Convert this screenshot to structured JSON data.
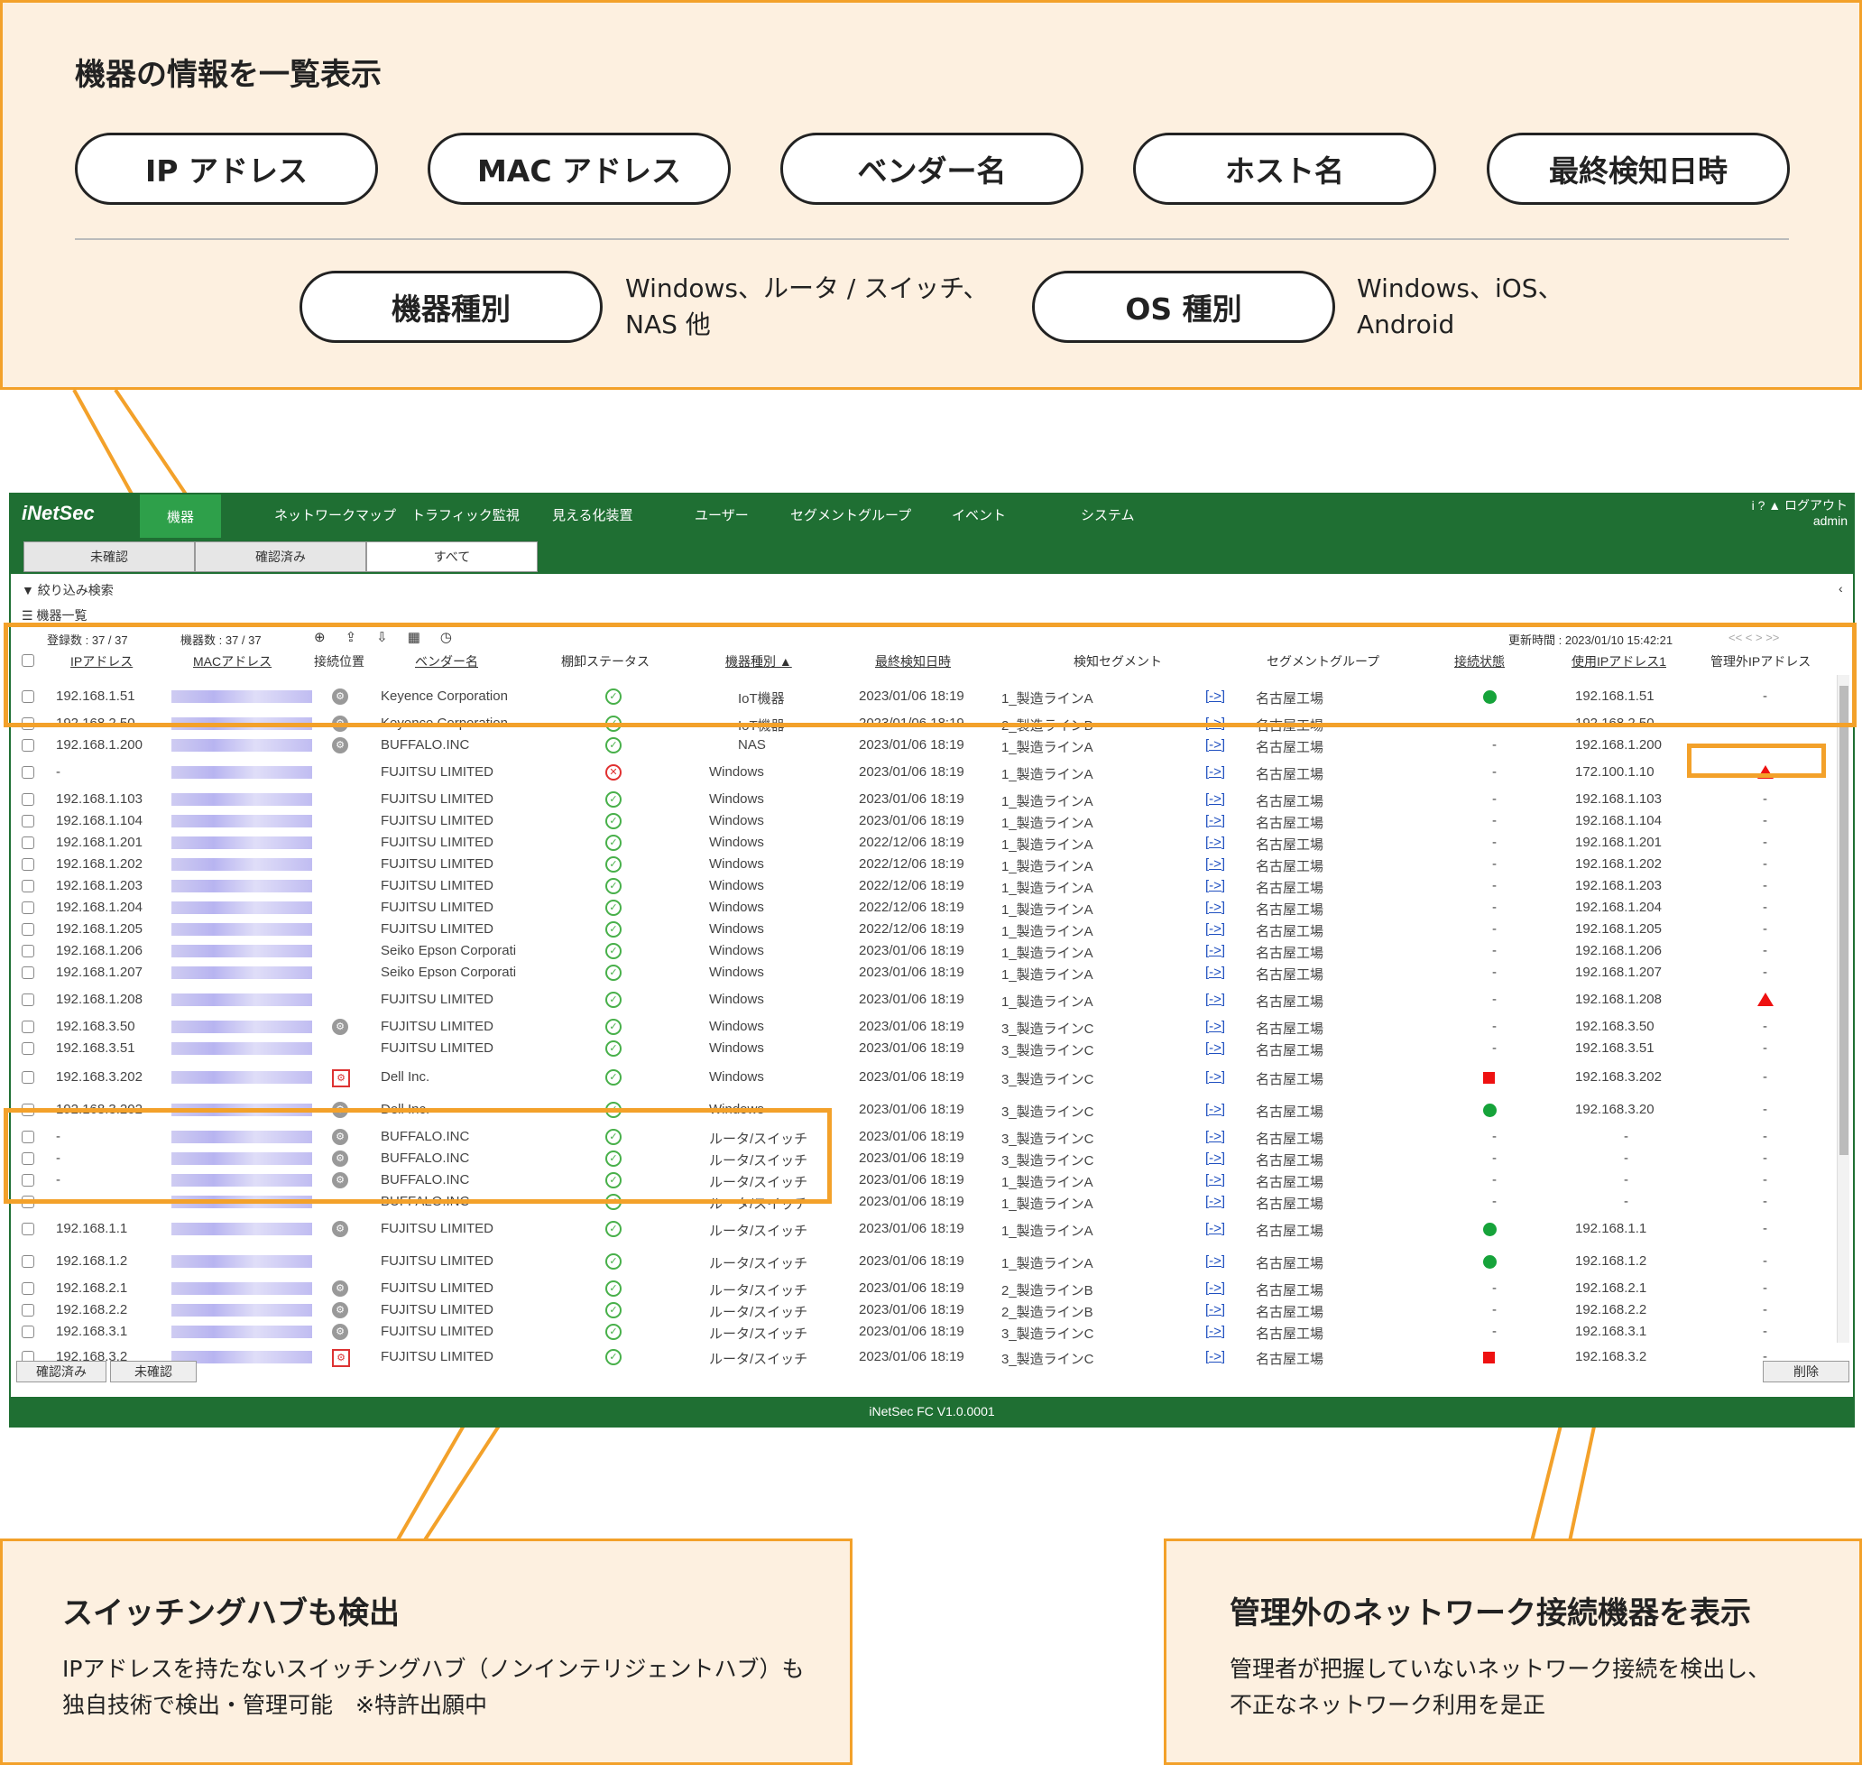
{
  "top": {
    "title": "機器の情報を一覧表示",
    "pills": [
      "IP アドレス",
      "MAC アドレス",
      "ベンダー名",
      "ホスト名",
      "最終検知日時"
    ],
    "pill_device": "機器種別",
    "device_desc1": "Windows、ルータ / スイッチ、",
    "device_desc2": "NAS 他",
    "pill_os": "OS 種別",
    "os_desc1": "Windows、iOS、",
    "os_desc2": "Android"
  },
  "app": {
    "logo": "iNetSec",
    "nav": [
      "機器",
      "ネットワークマップ",
      "トラフィック監視",
      "見える化装置",
      "ユーザー",
      "セグメントグループ",
      "イベント",
      "システム"
    ],
    "user_links": "i ? ▲ ログアウト",
    "user": "admin",
    "tabs": [
      "未確認",
      "確認済み",
      "すべて"
    ],
    "filter": "絞り込み検索",
    "list": "機器一覧",
    "reg_count": "登録数 : 37 / 37",
    "dev_count": "機器数 : 37 / 37",
    "updated": "更新時間 : 2023/01/10 15:42:21",
    "pager": "<< < > >>",
    "headers": [
      "IPアドレス",
      "MACアドレス",
      "接続位置",
      "ベンダー名",
      "棚卸ステータス",
      "機器種別 ▲",
      "最終検知日時",
      "検知セグメント",
      "セグメントグループ",
      "接続状態",
      "使用IPアドレス1",
      "管理外IPアドレス"
    ],
    "rows": [
      {
        "ip": "192.168.1.51",
        "loc": "g",
        "vendor": "Keyence Corporation",
        "status": "ok",
        "type": "IoT機器",
        "date": "2023/01/06 18:19",
        "seg": "1_製造ラインA",
        "group": "名古屋工場",
        "conn": "green",
        "ip1": "192.168.1.51",
        "ext": "-"
      },
      {
        "ip": "192.168.2.50",
        "loc": "g",
        "vendor": "Keyence Corporation",
        "status": "ok",
        "type": "IoT機器",
        "date": "2023/01/06 18:19",
        "seg": "2_製造ラインB",
        "group": "名古屋工場",
        "conn": "-",
        "ip1": "192.168.2.50",
        "ext": "-"
      },
      {
        "ip": "192.168.1.200",
        "loc": "g",
        "vendor": "BUFFALO.INC",
        "status": "ok",
        "type": "NAS",
        "date": "2023/01/06 18:19",
        "seg": "1_製造ラインA",
        "group": "名古屋工場",
        "conn": "-",
        "ip1": "192.168.1.200",
        "ext": "-"
      },
      {
        "ip": "-",
        "loc": "",
        "vendor": "FUJITSU LIMITED",
        "status": "ng",
        "type": "Windows",
        "date": "2023/01/06 18:19",
        "seg": "1_製造ラインA",
        "group": "名古屋工場",
        "conn": "-",
        "ip1": "172.100.1.10",
        "ext": "tri"
      },
      {
        "ip": "192.168.1.103",
        "loc": "",
        "vendor": "FUJITSU LIMITED",
        "status": "ok",
        "type": "Windows",
        "date": "2023/01/06 18:19",
        "seg": "1_製造ラインA",
        "group": "名古屋工場",
        "conn": "-",
        "ip1": "192.168.1.103",
        "ext": "-"
      },
      {
        "ip": "192.168.1.104",
        "loc": "",
        "vendor": "FUJITSU LIMITED",
        "status": "ok",
        "type": "Windows",
        "date": "2023/01/06 18:19",
        "seg": "1_製造ラインA",
        "group": "名古屋工場",
        "conn": "-",
        "ip1": "192.168.1.104",
        "ext": "-"
      },
      {
        "ip": "192.168.1.201",
        "loc": "",
        "vendor": "FUJITSU LIMITED",
        "status": "ok",
        "type": "Windows",
        "date": "2022/12/06 18:19",
        "seg": "1_製造ラインA",
        "group": "名古屋工場",
        "conn": "-",
        "ip1": "192.168.1.201",
        "ext": "-"
      },
      {
        "ip": "192.168.1.202",
        "loc": "",
        "vendor": "FUJITSU LIMITED",
        "status": "ok",
        "type": "Windows",
        "date": "2022/12/06 18:19",
        "seg": "1_製造ラインA",
        "group": "名古屋工場",
        "conn": "-",
        "ip1": "192.168.1.202",
        "ext": "-"
      },
      {
        "ip": "192.168.1.203",
        "loc": "",
        "vendor": "FUJITSU LIMITED",
        "status": "ok",
        "type": "Windows",
        "date": "2022/12/06 18:19",
        "seg": "1_製造ラインA",
        "group": "名古屋工場",
        "conn": "-",
        "ip1": "192.168.1.203",
        "ext": "-"
      },
      {
        "ip": "192.168.1.204",
        "loc": "",
        "vendor": "FUJITSU LIMITED",
        "status": "ok",
        "type": "Windows",
        "date": "2022/12/06 18:19",
        "seg": "1_製造ラインA",
        "group": "名古屋工場",
        "conn": "-",
        "ip1": "192.168.1.204",
        "ext": "-"
      },
      {
        "ip": "192.168.1.205",
        "loc": "",
        "vendor": "FUJITSU LIMITED",
        "status": "ok",
        "type": "Windows",
        "date": "2022/12/06 18:19",
        "seg": "1_製造ラインA",
        "group": "名古屋工場",
        "conn": "-",
        "ip1": "192.168.1.205",
        "ext": "-"
      },
      {
        "ip": "192.168.1.206",
        "loc": "",
        "vendor": "Seiko Epson Corporati",
        "status": "ok",
        "type": "Windows",
        "date": "2023/01/06 18:19",
        "seg": "1_製造ラインA",
        "group": "名古屋工場",
        "conn": "-",
        "ip1": "192.168.1.206",
        "ext": "-"
      },
      {
        "ip": "192.168.1.207",
        "loc": "",
        "vendor": "Seiko Epson Corporati",
        "status": "ok",
        "type": "Windows",
        "date": "2023/01/06 18:19",
        "seg": "1_製造ラインA",
        "group": "名古屋工場",
        "conn": "-",
        "ip1": "192.168.1.207",
        "ext": "-"
      },
      {
        "ip": "192.168.1.208",
        "loc": "",
        "vendor": "FUJITSU LIMITED",
        "status": "ok",
        "type": "Windows",
        "date": "2023/01/06 18:19",
        "seg": "1_製造ラインA",
        "group": "名古屋工場",
        "conn": "-",
        "ip1": "192.168.1.208",
        "ext": "tri"
      },
      {
        "ip": "192.168.3.50",
        "loc": "g",
        "vendor": "FUJITSU LIMITED",
        "status": "ok",
        "type": "Windows",
        "date": "2023/01/06 18:19",
        "seg": "3_製造ラインC",
        "group": "名古屋工場",
        "conn": "-",
        "ip1": "192.168.3.50",
        "ext": "-"
      },
      {
        "ip": "192.168.3.51",
        "loc": "",
        "vendor": "FUJITSU LIMITED",
        "status": "ok",
        "type": "Windows",
        "date": "2023/01/06 18:19",
        "seg": "3_製造ラインC",
        "group": "名古屋工場",
        "conn": "-",
        "ip1": "192.168.3.51",
        "ext": "-"
      },
      {
        "ip": "192.168.3.202",
        "loc": "r",
        "vendor": "Dell Inc.",
        "status": "ok",
        "type": "Windows",
        "date": "2023/01/06 18:19",
        "seg": "3_製造ラインC",
        "group": "名古屋工場",
        "conn": "red",
        "ip1": "192.168.3.202",
        "ext": "-"
      },
      {
        "ip": "192.168.3.202",
        "loc": "g",
        "vendor": "Dell Inc.",
        "status": "ok",
        "type": "Windows",
        "date": "2023/01/06 18:19",
        "seg": "3_製造ラインC",
        "group": "名古屋工場",
        "conn": "green",
        "ip1": "192.168.3.20",
        "ext": "-"
      },
      {
        "ip": "-",
        "loc": "g",
        "vendor": "BUFFALO.INC",
        "status": "ok",
        "type": "ルータ/スイッチ",
        "date": "2023/01/06 18:19",
        "seg": "3_製造ラインC",
        "group": "名古屋工場",
        "conn": "-",
        "ip1": "-",
        "ext": "-"
      },
      {
        "ip": "-",
        "loc": "g",
        "vendor": "BUFFALO.INC",
        "status": "ok",
        "type": "ルータ/スイッチ",
        "date": "2023/01/06 18:19",
        "seg": "3_製造ラインC",
        "group": "名古屋工場",
        "conn": "-",
        "ip1": "-",
        "ext": "-"
      },
      {
        "ip": "-",
        "loc": "g",
        "vendor": "BUFFALO.INC",
        "status": "ok",
        "type": "ルータ/スイッチ",
        "date": "2023/01/06 18:19",
        "seg": "1_製造ラインA",
        "group": "名古屋工場",
        "conn": "-",
        "ip1": "-",
        "ext": "-"
      },
      {
        "ip": "-",
        "loc": "",
        "vendor": "BUFFALO.INC",
        "status": "ok",
        "type": "ルータ/スイッチ",
        "date": "2023/01/06 18:19",
        "seg": "1_製造ラインA",
        "group": "名古屋工場",
        "conn": "-",
        "ip1": "-",
        "ext": "-"
      },
      {
        "ip": "192.168.1.1",
        "loc": "g",
        "vendor": "FUJITSU LIMITED",
        "status": "ok",
        "type": "ルータ/スイッチ",
        "date": "2023/01/06 18:19",
        "seg": "1_製造ラインA",
        "group": "名古屋工場",
        "conn": "green",
        "ip1": "192.168.1.1",
        "ext": "-"
      },
      {
        "ip": "192.168.1.2",
        "loc": "",
        "vendor": "FUJITSU LIMITED",
        "status": "ok",
        "type": "ルータ/スイッチ",
        "date": "2023/01/06 18:19",
        "seg": "1_製造ラインA",
        "group": "名古屋工場",
        "conn": "green",
        "ip1": "192.168.1.2",
        "ext": "-"
      },
      {
        "ip": "192.168.2.1",
        "loc": "g",
        "vendor": "FUJITSU LIMITED",
        "status": "ok",
        "type": "ルータ/スイッチ",
        "date": "2023/01/06 18:19",
        "seg": "2_製造ラインB",
        "group": "名古屋工場",
        "conn": "-",
        "ip1": "192.168.2.1",
        "ext": "-"
      },
      {
        "ip": "192.168.2.2",
        "loc": "g",
        "vendor": "FUJITSU LIMITED",
        "status": "ok",
        "type": "ルータ/スイッチ",
        "date": "2023/01/06 18:19",
        "seg": "2_製造ラインB",
        "group": "名古屋工場",
        "conn": "-",
        "ip1": "192.168.2.2",
        "ext": "-"
      },
      {
        "ip": "192.168.3.1",
        "loc": "g",
        "vendor": "FUJITSU LIMITED",
        "status": "ok",
        "type": "ルータ/スイッチ",
        "date": "2023/01/06 18:19",
        "seg": "3_製造ラインC",
        "group": "名古屋工場",
        "conn": "-",
        "ip1": "192.168.3.1",
        "ext": "-"
      },
      {
        "ip": "192.168.3.2",
        "loc": "r",
        "vendor": "FUJITSU LIMITED",
        "status": "ok",
        "type": "ルータ/スイッチ",
        "date": "2023/01/06 18:19",
        "seg": "3_製造ラインC",
        "group": "名古屋工場",
        "conn": "red",
        "ip1": "192.168.3.2",
        "ext": "-"
      }
    ],
    "link": "[->]",
    "btn_confirmed": "確認済み",
    "btn_unconfirmed": "未確認",
    "btn_delete": "削除",
    "footer": "iNetSec FC V1.0.0001"
  },
  "bottom_left": {
    "title": "スイッチングハブも検出",
    "line1": "IPアドレスを持たないスイッチングハブ（ノンインテリジェントハブ）も",
    "line2": "独自技術で検出・管理可能　※特許出願中"
  },
  "bottom_right": {
    "title": "管理外のネットワーク接続機器を表示",
    "line1": "管理者が把握していないネットワーク接続を検出し、",
    "line2": "不正なネットワーク利用を是正"
  }
}
